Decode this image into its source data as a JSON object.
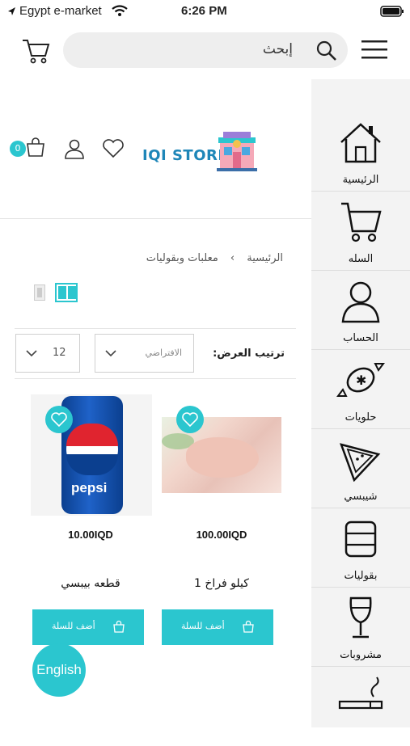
{
  "status": {
    "carrier": "Egypt e-market",
    "time": "6:26 PM"
  },
  "header": {
    "search_placeholder": "إبحث"
  },
  "store": {
    "logo_text": "IQI STORE",
    "cart_badge": "0"
  },
  "breadcrumb": {
    "home": "الرئيسية",
    "separator": "›",
    "current": "معلبات وبقوليات"
  },
  "sort": {
    "label": "ترتيب العرض:",
    "selected": "الافتراضي",
    "per_page": "12"
  },
  "products": [
    {
      "name": "1 كيلو فراخ",
      "price": "100.00IQD",
      "button": "أضف للسلة"
    },
    {
      "name": "قطعه بيبسي",
      "price": "10.00IQD",
      "button": "أضف للسلة"
    }
  ],
  "sidebar": {
    "items": [
      {
        "label": "الرئيسية",
        "icon": "home-icon"
      },
      {
        "label": "السله",
        "icon": "cart-icon"
      },
      {
        "label": "الحساب",
        "icon": "user-icon"
      },
      {
        "label": "حلويات",
        "icon": "candy-icon"
      },
      {
        "label": "شيبسي",
        "icon": "chips-icon"
      },
      {
        "label": "بقوليات",
        "icon": "can-icon"
      },
      {
        "label": "مشروبات",
        "icon": "wine-glass-icon"
      },
      {
        "label": "",
        "icon": "cigarette-icon"
      }
    ]
  },
  "language_button": "English",
  "colors": {
    "accent": "#2bc6cf",
    "sidebar_bg": "#f3f3f3"
  }
}
